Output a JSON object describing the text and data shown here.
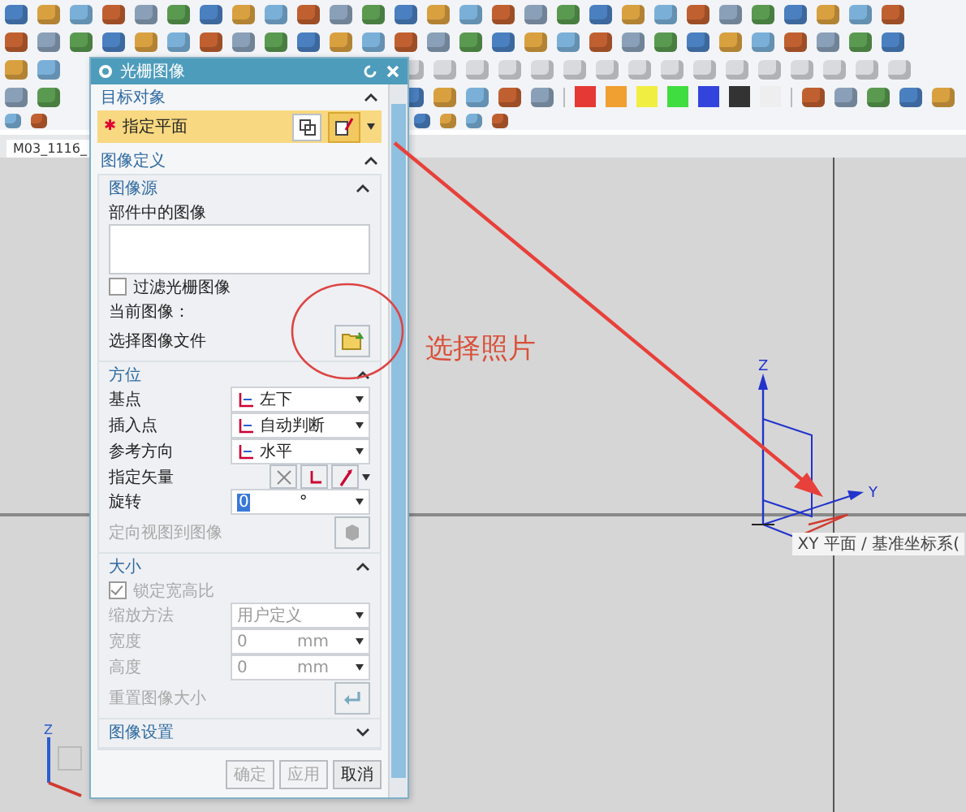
{
  "toolbar": {
    "swatches": [
      {
        "color": "#e53935"
      },
      {
        "color": "#f0a030"
      },
      {
        "color": "#f0ee40"
      },
      {
        "color": "#40dd40"
      },
      {
        "color": "#3344dd"
      },
      {
        "color": "#333333"
      },
      {
        "color": "#eeeeee"
      }
    ]
  },
  "document_tab": {
    "label": "M03_1116_"
  },
  "dialog": {
    "title": "光栅图像",
    "target": {
      "header": "目标对象",
      "expanded": true,
      "required_mark": "✱",
      "label": "指定平面"
    },
    "definition": {
      "header": "图像定义",
      "expanded": true,
      "groups": [
        {
          "header": "图像源",
          "expanded": true,
          "rows": [
            {
              "kind": "label",
              "label": "部件中的图像",
              "disabled": false
            },
            {
              "kind": "listbox"
            },
            {
              "kind": "checkbox",
              "label": "过滤光栅图像",
              "checked": false,
              "disabled": false
            },
            {
              "kind": "label",
              "label": "当前图像：",
              "disabled": false
            },
            {
              "kind": "folder-button",
              "label": "选择图像文件",
              "disabled": false
            }
          ]
        },
        {
          "header": "方位",
          "expanded": true,
          "rows": [
            {
              "kind": "icon-select",
              "label": "基点",
              "value": "左下",
              "disabled": false
            },
            {
              "kind": "icon-select",
              "label": "插入点",
              "value": "自动判断",
              "disabled": false
            },
            {
              "kind": "icon-select",
              "label": "参考方向",
              "value": "水平",
              "disabled": false
            },
            {
              "kind": "vector",
              "label": "指定矢量",
              "disabled": false
            },
            {
              "kind": "input",
              "label": "旋转",
              "value": "0",
              "unit": "°",
              "text_selected": true,
              "disabled": false
            },
            {
              "kind": "view-button",
              "label": "定向视图到图像",
              "disabled": true
            }
          ]
        },
        {
          "header": "大小",
          "expanded": true,
          "rows": [
            {
              "kind": "checkbox",
              "label": "锁定宽高比",
              "checked": true,
              "disabled": true
            },
            {
              "kind": "select",
              "label": "缩放方法",
              "value": "用户定义",
              "disabled": true
            },
            {
              "kind": "input",
              "label": "宽度",
              "value": "0",
              "unit": "mm",
              "text_selected": false,
              "disabled": true
            },
            {
              "kind": "input",
              "label": "高度",
              "value": "0",
              "unit": "mm",
              "text_selected": false,
              "disabled": true
            },
            {
              "kind": "reset-button",
              "label": "重置图像大小",
              "disabled": true
            }
          ]
        },
        {
          "header": "图像设置",
          "expanded": false
        }
      ]
    },
    "buttons": [
      {
        "label": "确定",
        "disabled": true
      },
      {
        "label": "应用",
        "disabled": true
      },
      {
        "label": "取消",
        "disabled": false
      }
    ]
  },
  "viewport": {
    "annotation": "选择照片",
    "csys_labels": [
      "Z",
      "Y"
    ],
    "tooltip": "XY 平面 / 基准坐标系(",
    "triad_label": "Z"
  }
}
